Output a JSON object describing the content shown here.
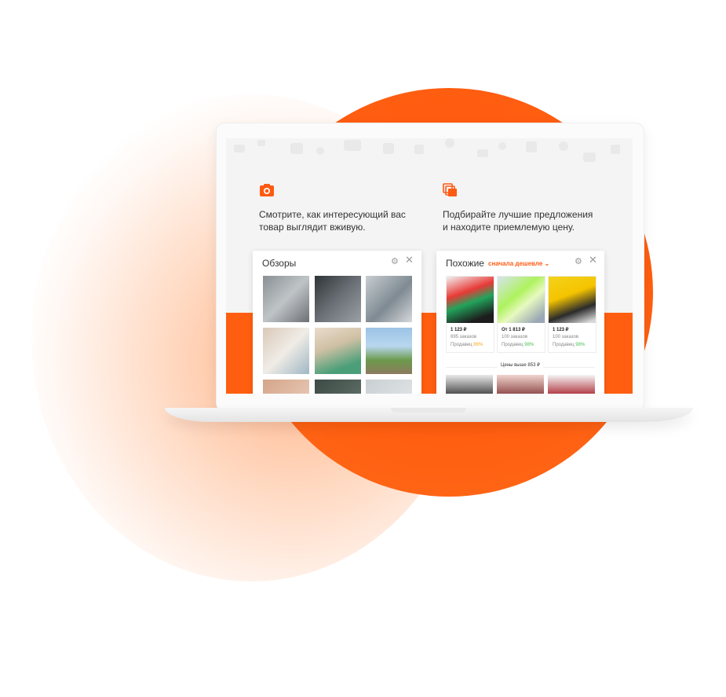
{
  "features": [
    {
      "icon": "camera-icon",
      "text_line1": "Смотрите, как интересующий вас",
      "text_line2": "товар выглядит вживую."
    },
    {
      "icon": "copies-icon",
      "text_line1": "Подбирайте лучшие предложения",
      "text_line2": "и находите приемлемую цену."
    }
  ],
  "reviews_panel": {
    "title": "Обзоры"
  },
  "similar_panel": {
    "title": "Похожие",
    "sort_label": "сначала дешевле",
    "products": [
      {
        "price": "1 123 ₽",
        "orders": "695 заказов",
        "seller_label": "Продавец",
        "seller_score": "86%",
        "seller_color": "#f7a823"
      },
      {
        "price": "От 1 813 ₽",
        "orders": "100 заказов",
        "seller_label": "Продавец",
        "seller_score": "98%",
        "seller_color": "#4cc157"
      },
      {
        "price": "1 123 ₽",
        "orders": "100 заказов",
        "seller_label": "Продавец",
        "seller_score": "98%",
        "seller_color": "#4cc157"
      }
    ],
    "higher_prices_label": "Цены выше 853 ₽"
  },
  "colors": {
    "accent": "#ff5a12"
  }
}
